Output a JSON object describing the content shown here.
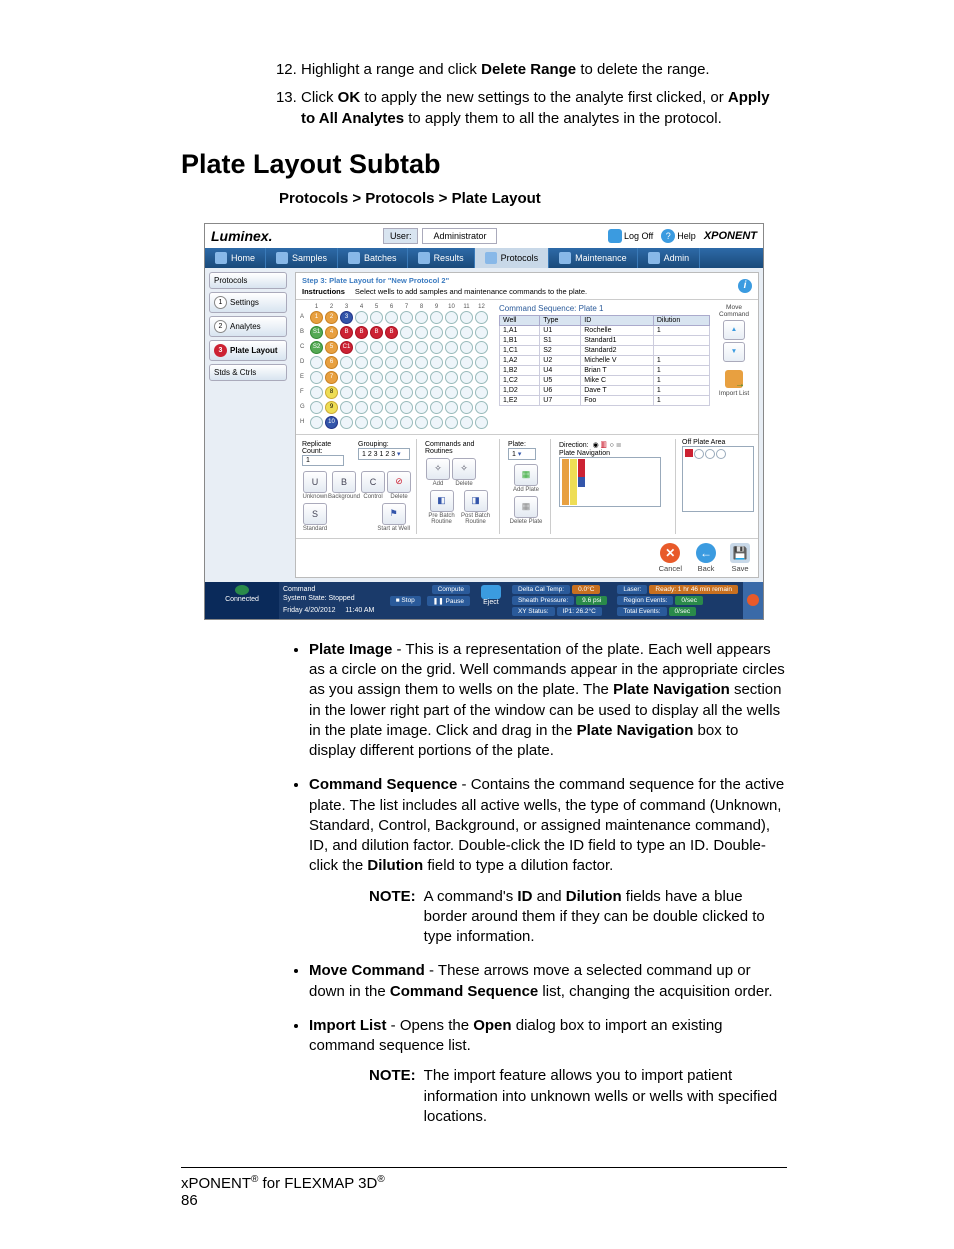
{
  "steps": {
    "start": 12,
    "items": [
      {
        "pre": "Highlight a range and click ",
        "b1": "Delete Range",
        "post": " to delete the range."
      },
      {
        "pre": "Click ",
        "b1": "OK",
        "mid": " to apply the new settings to the analyte first clicked, or ",
        "b2": "Apply to All Analytes",
        "post": " to apply them to all the analytes in the protocol."
      }
    ]
  },
  "heading": "Plate Layout Subtab",
  "breadcrumb": {
    "a": "Protocols",
    "sep1": " > ",
    "b": "Protocols",
    "sep2": " > ",
    "c": "Plate Layout"
  },
  "screenshot": {
    "logo": "Luminex.",
    "user_label": "User:",
    "user_value": "Administrator",
    "logoff": "Log Off",
    "help": "Help",
    "brand": "XPONENT",
    "nav": [
      "Home",
      "Samples",
      "Batches",
      "Results",
      "Protocols",
      "Maintenance",
      "Admin"
    ],
    "nav_active": "Protocols",
    "side": [
      {
        "n": "",
        "label": "Protocols"
      },
      {
        "n": "1",
        "label": "Settings"
      },
      {
        "n": "2",
        "label": "Analytes"
      },
      {
        "n": "3",
        "label": "Plate Layout",
        "active": true
      },
      {
        "n": "",
        "label": "Stds & Ctrls"
      }
    ],
    "step_title": "Step 3: Plate Layout for \"New Protocol 2\"",
    "instructions_label": "Instructions",
    "instructions_text": "Select wells to add samples and maintenance commands to the plate.",
    "seq_title": "Command Sequence: Plate 1",
    "seq_cols": [
      "Well",
      "Type",
      "ID",
      "Dilution"
    ],
    "seq_rows": [
      [
        "1,A1",
        "U1",
        "Rochelle",
        "1"
      ],
      [
        "1,B1",
        "S1",
        "Standard1",
        ""
      ],
      [
        "1,C1",
        "S2",
        "Standard2",
        ""
      ],
      [
        "1,A2",
        "U2",
        "Michelle V",
        "1"
      ],
      [
        "1,B2",
        "U4",
        "Brian T",
        "1"
      ],
      [
        "1,C2",
        "U5",
        "Mike C",
        "1"
      ],
      [
        "1,D2",
        "U6",
        "Dave T",
        "1"
      ],
      [
        "1,E2",
        "U7",
        "Foo",
        "1"
      ]
    ],
    "move_cmd": "Move Command",
    "import_list": "Import List",
    "replicate_count": "Replicate Count:",
    "replicate_val": "1",
    "grouping": "Grouping:",
    "grouping_val": "1 2 3 1 2 3",
    "cmd_routines": "Commands and Routines",
    "btn_u": "U",
    "btn_b": "B",
    "btn_c": "C",
    "btn_s": "S",
    "lbl_unknown": "Unknown",
    "lbl_background": "Background",
    "lbl_control": "Control",
    "lbl_delete": "Delete",
    "lbl_standard": "Standard",
    "lbl_startwell": "Start at Well",
    "lbl_add": "Add",
    "lbl_del": "Delete",
    "lbl_prebatch": "Pre Batch Routine",
    "lbl_postbatch": "Post Batch Routine",
    "plate_label": "Plate:",
    "plate_val": "1",
    "add_plate": "Add Plate",
    "delete_plate": "Delete Plate",
    "direction": "Direction:",
    "plate_nav": "Plate Navigation",
    "off_plate": "Off Plate Area",
    "cancel": "Cancel",
    "back": "Back",
    "save": "Save",
    "status": {
      "connected": "Connected",
      "command": "Command",
      "compute": "Compute",
      "stop": "Stop",
      "pause": "Pause",
      "eject": "Eject",
      "sys_state": "System State: Stopped",
      "date": "Friday 4/20/2012",
      "time": "11:40 AM",
      "dct": "Delta Cal Temp:",
      "dct_v": "0.0°C",
      "sp": "Sheath Pressure:",
      "sp_v": "9.6 psi",
      "xy": "XY Status:",
      "xy_v": "IP1: 26.2°C",
      "laser": "Laser:",
      "laser_v": "Ready: 1 hr 46 min remain",
      "re": "Region Events:",
      "re_v": "0/sec",
      "te": "Total Events:",
      "te_v": "0/sec"
    }
  },
  "bullets": [
    {
      "term": "Plate Image",
      "body1": " - This is a representation of the plate. Each well appears as a circle on the grid. Well commands appear in the appropriate circles as you assign them to wells on the plate. The ",
      "b2": "Plate Navigation",
      "body2": " section in the lower right part of the window can be used to display all the wells in the plate image. Click and drag in the ",
      "b3": "Plate Navigation",
      "body3": " box to display different portions of the plate."
    },
    {
      "term": "Command Sequence",
      "body1": " - Contains the command sequence for the active plate. The list includes all active wells, the type of command (Unknown, Standard, Control, Background, or assigned maintenance command), ID, and dilution factor. Double-click the ID field to type an ID. Double-click the ",
      "b2": "Dilution",
      "body2": " field to type a dilution factor."
    },
    {
      "term": "Move Command",
      "body1": " - These arrows move a selected command up or down in the ",
      "b2": "Command Sequence",
      "body2": " list, changing the acquisition order."
    },
    {
      "term": "Import List",
      "body1": " - Opens the ",
      "b2": "Open",
      "body2": " dialog box to import an existing command sequence list."
    }
  ],
  "notes": [
    {
      "label": "NOTE:",
      "pre": "A command's ",
      "b1": "ID",
      "mid": " and ",
      "b2": "Dilution",
      "post": " fields have a blue border around them if they can be double clicked to type information."
    },
    {
      "label": "NOTE:",
      "text": "The import feature allows you to import patient information into unknown wells or wells with specified locations."
    }
  ],
  "footer": {
    "a": "xPONENT",
    "r1": "®",
    "b": " for FLEXMAP 3D",
    "r2": "®",
    "page": "86"
  }
}
